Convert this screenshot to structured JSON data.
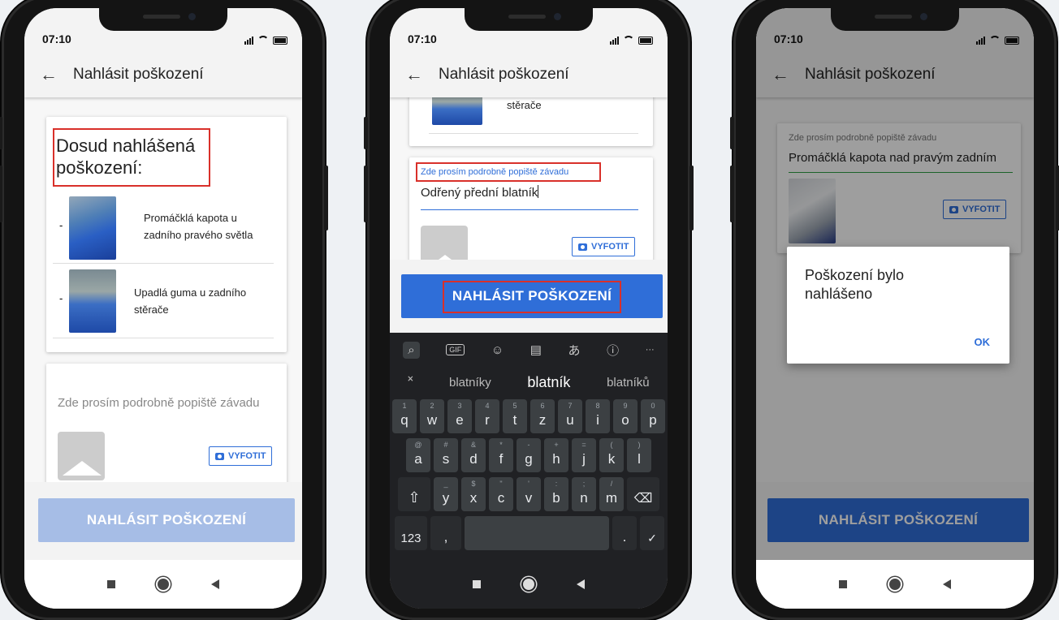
{
  "status": {
    "time": "07:10"
  },
  "appbar": {
    "back_icon": "←",
    "title": "Nahlásit poškození"
  },
  "screen1": {
    "heading": "Dosud nahlášená poškození:",
    "damages": [
      {
        "bullet": "-",
        "text": "Promáčklá kapota u zadního pravého světla"
      },
      {
        "bullet": "-",
        "text": "Upadlá guma u zadního stěrače"
      }
    ],
    "description_placeholder": "Zde prosím podrobně popiště závadu",
    "photo_button": "VYFOTIT",
    "submit_button": "NAHLÁSIT POŠKOZENÍ"
  },
  "screen2": {
    "partial_item": "stěrače",
    "description_label": "Zde prosím podrobně popiště závadu",
    "description_value": "Odřený přední blatník",
    "photo_button": "VYFOTIT",
    "submit_button": "NAHLÁSIT POŠKOZENÍ",
    "keyboard": {
      "tools": [
        "search-icon",
        "gif-icon",
        "sticker-icon",
        "clipboard-icon",
        "translate-icon",
        "info-icon",
        "more-icon"
      ],
      "tool_glyphs": [
        "⌕",
        "GIF",
        "☺",
        "▤",
        "あ",
        "ⓘ",
        "···"
      ],
      "suggestions": [
        "blatníky",
        "blatník",
        "blatníků"
      ],
      "collapse_glyph": "˟",
      "row1": [
        [
          "q",
          "1"
        ],
        [
          "w",
          "2"
        ],
        [
          "e",
          "3"
        ],
        [
          "r",
          "4"
        ],
        [
          "t",
          "5"
        ],
        [
          "z",
          "6"
        ],
        [
          "u",
          "7"
        ],
        [
          "i",
          "8"
        ],
        [
          "o",
          "9"
        ],
        [
          "p",
          "0"
        ]
      ],
      "row2": [
        [
          "a",
          "@"
        ],
        [
          "s",
          "#"
        ],
        [
          "d",
          "&"
        ],
        [
          "f",
          "*"
        ],
        [
          "g",
          "-"
        ],
        [
          "h",
          "+"
        ],
        [
          "j",
          "="
        ],
        [
          "k",
          "("
        ],
        [
          "l",
          ")"
        ]
      ],
      "row3": [
        [
          "y",
          "_"
        ],
        [
          "x",
          "$"
        ],
        [
          "c",
          "\""
        ],
        [
          "v",
          "'"
        ],
        [
          "b",
          ":"
        ],
        [
          "n",
          ";"
        ],
        [
          "m",
          "/"
        ]
      ],
      "shift": "⇧",
      "backspace": "⌫",
      "numbers_key": "123",
      "comma": ",",
      "period": ".",
      "enter": "✓"
    }
  },
  "screen3": {
    "description_label": "Zde prosím podrobně popiště závadu",
    "description_value": "Promáčklá kapota nad pravým zadním",
    "photo_button": "VYFOTIT",
    "dialog_message": "Poškození bylo nahlášeno",
    "dialog_ok": "OK",
    "submit_button": "NAHLÁSIT POŠKOZENÍ"
  },
  "colors": {
    "accent": "#2f6ed8",
    "highlight": "#d9302a",
    "disabled_button": "#a6bde6",
    "keyboard_bg": "#202124"
  }
}
